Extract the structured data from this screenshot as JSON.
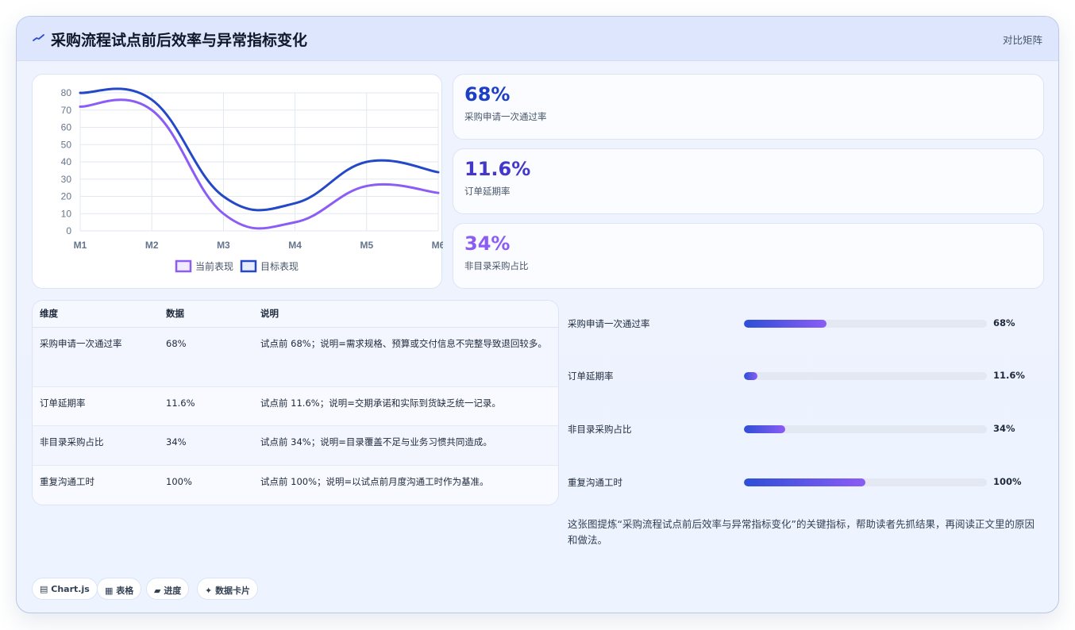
{
  "header": {
    "icon": "trend-line-icon",
    "title": "采购流程试点前后效率与异常指标变化",
    "right_label": "对比矩阵"
  },
  "chart_data": {
    "type": "line",
    "categories": [
      "M1",
      "M2",
      "M3",
      "M4",
      "M5",
      "M6"
    ],
    "series": [
      {
        "name": "当前表现",
        "values": [
          72,
          70,
          10,
          5,
          26,
          22
        ],
        "color": "#8b5cf6"
      },
      {
        "name": "目标表现",
        "values": [
          80,
          76,
          20,
          16,
          40,
          34
        ],
        "color": "#2448c8"
      }
    ],
    "ylim": [
      0,
      80
    ],
    "yticks": [
      0,
      10,
      20,
      30,
      40,
      50,
      60,
      70,
      80
    ],
    "grid": true,
    "legend_position": "bottom",
    "smooth": true
  },
  "stats": [
    {
      "value": "68%",
      "label": "采购申请一次通过率",
      "color": "#1d3fc4"
    },
    {
      "value": "11.6%",
      "label": "订单延期率",
      "color": "#4338ca"
    },
    {
      "value": "34%",
      "label": "非目录采购占比",
      "color": "#8b5cf6"
    }
  ],
  "table": {
    "headers": [
      "维度",
      "数据",
      "说明"
    ],
    "rows": [
      [
        "采购申请一次通过率",
        "68%",
        "试点前 68%；说明=需求规格、预算或交付信息不完整导致退回较多。"
      ],
      [
        "订单延期率",
        "11.6%",
        "试点前 11.6%；说明=交期承诺和实际到货缺乏统一记录。"
      ],
      [
        "非目录采购占比",
        "34%",
        "试点前 34%；说明=目录覆盖不足与业务习惯共同造成。"
      ],
      [
        "重复沟通工时",
        "100%",
        "试点前 100%；说明=以试点前月度沟通工时作为基准。"
      ]
    ]
  },
  "progress": [
    {
      "label": "采购申请一次通过率",
      "value": "68%",
      "fraction": 0.34
    },
    {
      "label": "订单延期率",
      "value": "11.6%",
      "fraction": 0.055
    },
    {
      "label": "非目录采购占比",
      "value": "34%",
      "fraction": 0.17
    },
    {
      "label": "重复沟通工时",
      "value": "100%",
      "fraction": 0.5
    }
  ],
  "summary": "这张图提炼“采购流程试点前后效率与异常指标变化”的关键指标，帮助读者先抓结果，再阅读正文里的原因和做法。",
  "chips": [
    {
      "icon": "chart-icon",
      "glyph": "▤",
      "label": "Chart.js"
    },
    {
      "icon": "table-icon",
      "glyph": "▦",
      "label": "表格"
    },
    {
      "icon": "progress-icon",
      "glyph": "▰",
      "label": "进度"
    },
    {
      "icon": "sparkle-icon",
      "glyph": "✦",
      "label": "数据卡片"
    }
  ]
}
